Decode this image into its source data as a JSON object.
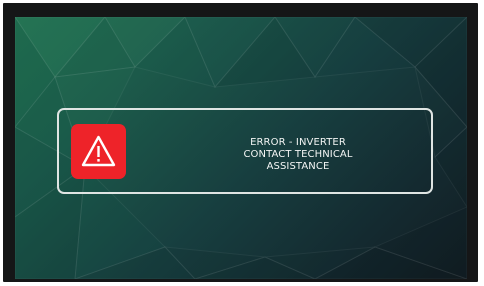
{
  "alert": {
    "icon": "warning-triangle-icon",
    "icon_color": "#ee2329",
    "lines": [
      "ERROR - INVERTER",
      "CONTACT TECHNICAL",
      "ASSISTANCE"
    ]
  },
  "theme": {
    "background_from": "#1f6a4e",
    "background_to": "#121d22",
    "frame": "#151617"
  }
}
